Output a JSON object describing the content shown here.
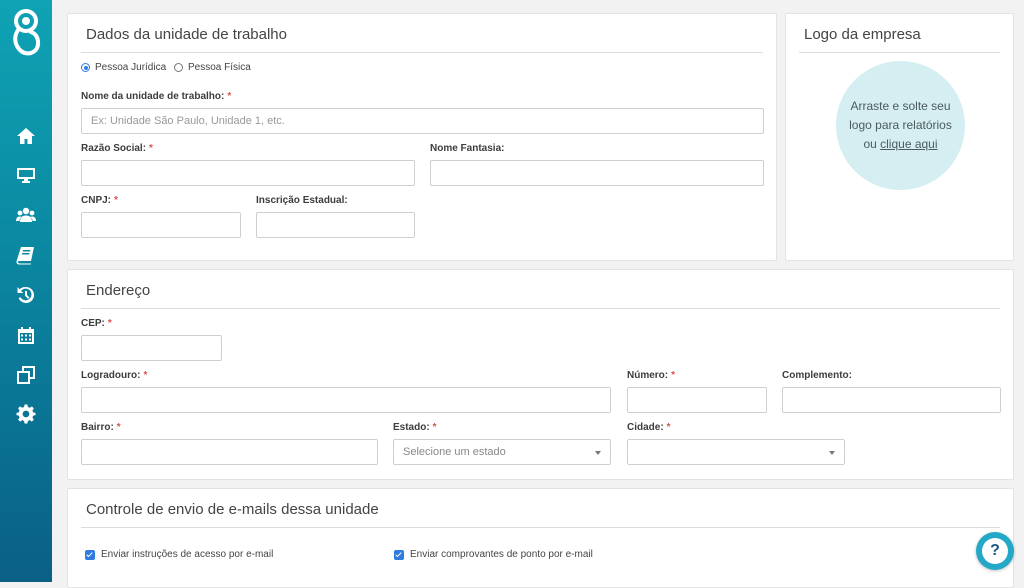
{
  "sidebar": {
    "items": [
      {
        "icon": "home-icon"
      },
      {
        "icon": "monitor-icon"
      },
      {
        "icon": "users-icon"
      },
      {
        "icon": "book-icon"
      },
      {
        "icon": "history-icon"
      },
      {
        "icon": "calendar-icon"
      },
      {
        "icon": "copy-icon"
      },
      {
        "icon": "gear-icon"
      }
    ]
  },
  "unit_card": {
    "title": "Dados da unidade de trabalho",
    "person_type": {
      "options": [
        "Pessoa Jurídica",
        "Pessoa Física"
      ],
      "selected": "Pessoa Jurídica"
    },
    "unit_name": {
      "label": "Nome da unidade de trabalho:",
      "required": "*",
      "placeholder": "Ex: Unidade São Paulo, Unidade 1, etc.",
      "value": ""
    },
    "razao_social": {
      "label": "Razão Social:",
      "required": "*",
      "value": ""
    },
    "nome_fantasia": {
      "label": "Nome Fantasia:",
      "value": ""
    },
    "cnpj": {
      "label": "CNPJ:",
      "required": "*",
      "value": ""
    },
    "inscricao_estadual": {
      "label": "Inscrição Estadual:",
      "value": ""
    }
  },
  "logo_card": {
    "title": "Logo da empresa",
    "drop_text_line1": "Arraste e solte seu",
    "drop_text_line2": "logo para relatórios",
    "drop_text_prefix": "ou ",
    "drop_text_link": "clique aqui"
  },
  "address_card": {
    "title": "Endereço",
    "cep": {
      "label": "CEP:",
      "required": "*",
      "value": ""
    },
    "logradouro": {
      "label": "Logradouro:",
      "required": "*",
      "value": ""
    },
    "numero": {
      "label": "Número:",
      "required": "*",
      "value": ""
    },
    "complemento": {
      "label": "Complemento:",
      "value": ""
    },
    "bairro": {
      "label": "Bairro:",
      "required": "*",
      "value": ""
    },
    "estado": {
      "label": "Estado:",
      "required": "*",
      "placeholder": "Selecione um estado"
    },
    "cidade": {
      "label": "Cidade:",
      "required": "*",
      "value": ""
    }
  },
  "email_card": {
    "title": "Controle de envio de e-mails dessa unidade",
    "send_access_instructions": {
      "label": "Enviar instruções de acesso por e-mail",
      "checked": true
    },
    "send_time_receipts": {
      "label": "Enviar comprovantes de ponto por e-mail",
      "checked": true
    }
  },
  "help": {
    "glyph": "?"
  },
  "colors": {
    "sidebar_top": "#0fa3b4",
    "sidebar_bottom": "#0a5f86",
    "accent": "#2f7de1",
    "required": "#d9534f",
    "logo_drop_bg": "#d5eef1",
    "help_button": "#23a8c7"
  }
}
